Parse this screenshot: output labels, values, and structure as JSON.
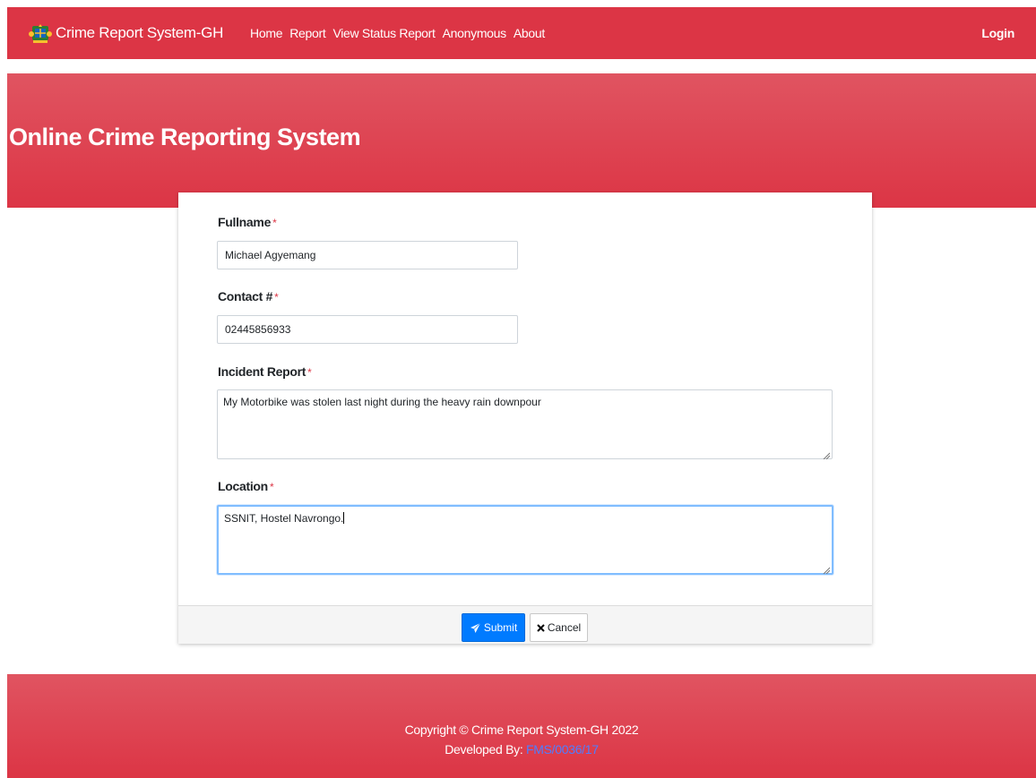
{
  "navbar": {
    "brand": "Crime Report System-GH",
    "logo_icon": "ghana-coat-of-arms-icon",
    "links": [
      "Home",
      "Report",
      "View Status Report",
      "Anonymous",
      "About"
    ],
    "login": "Login",
    "color": "#dc3545"
  },
  "hero": {
    "title": "Online Crime Reporting System"
  },
  "form": {
    "fullname": {
      "label": "Fullname",
      "required_mark": "*",
      "value": "Michael Agyemang"
    },
    "contact": {
      "label": "Contact #",
      "required_mark": "*",
      "value": "02445856933"
    },
    "incident": {
      "label": "Incident Report",
      "required_mark": "*",
      "value": "My Motorbike was stolen last night during the heavy rain downpour"
    },
    "location": {
      "label": "Location",
      "required_mark": "*",
      "value": "SSNIT, Hostel Navrongo."
    },
    "submit_label": "Submit",
    "submit_icon": "paper-plane-icon",
    "cancel_label": "Cancel",
    "cancel_icon": "close-icon"
  },
  "footer": {
    "copyright": "Copyright © Crime Report System-GH 2022",
    "developed_by": "Developed By:",
    "developer_id": "FMS/0036/17"
  }
}
